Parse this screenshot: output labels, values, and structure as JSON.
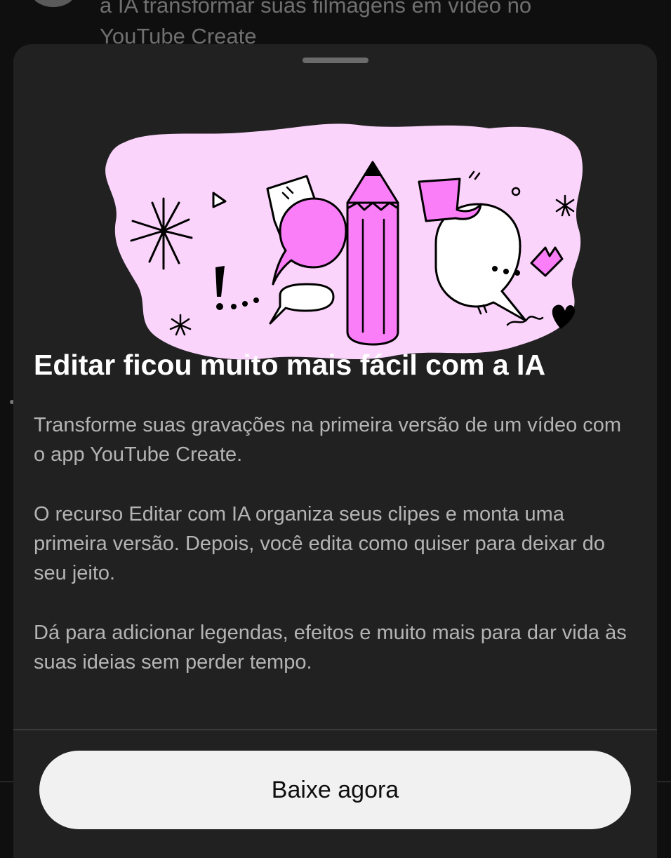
{
  "background": {
    "text_line1": "a IA transformar suas filmagens em vídeo no",
    "text_line2": "YouTube Create"
  },
  "sheet": {
    "title": "Editar ficou muito mais fácil com a IA",
    "paragraph1": "Transforme suas gravações na primeira versão de um vídeo com o app YouTube Create.",
    "paragraph2": "O recurso Editar com IA organiza seus clipes e monta uma primeira versão. Depois, você edita como quiser para deixar do seu jeito.",
    "paragraph3": "Dá para adicionar legendas, efeitos e muito mais para dar vida às suas ideias sem perder tempo.",
    "cta_label": "Baixe agora"
  },
  "illustration": {
    "icon": "pencil-and-speech-bubbles-illustration"
  },
  "colors": {
    "sheet_bg": "#212121",
    "accent_pink": "#f97ef7",
    "light_pink": "#fbd4fb",
    "button_bg": "#f1f1f1"
  }
}
